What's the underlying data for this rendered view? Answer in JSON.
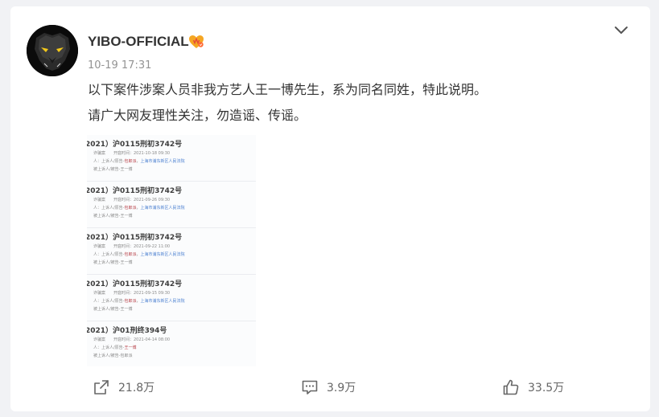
{
  "post": {
    "username": "YIBO-OFFICIAL",
    "badge_icon": "vip-heart-badge-icon",
    "timestamp": "10-19 17:31",
    "menu_icon": "chevron-down-icon",
    "content_lines": [
      "以下案件涉案人员非我方艺人王一博先生，系为同名同姓，特此说明。",
      "请广大网友理性关注，勿造谣、传谣。"
    ]
  },
  "image": {
    "cases": [
      {
        "title": "2021）沪0115刑初3742号",
        "line1": "诈骗案　　开庭时间：2021-10-18 09:30",
        "line2a": "人：上诉人/原告-",
        "line2b": "包郎派",
        "line2c": "上海市浦东新区人民法院",
        "line3": "被上诉人/被告-王一博"
      },
      {
        "title": "2021）沪0115刑初3742号",
        "line1": "诈骗案　　开庭时间：2021-09-26 09:30",
        "line2a": "人：上诉人/原告-",
        "line2b": "包郎派",
        "line2c": "上海市浦东新区人民法院",
        "line3": "被上诉人/被告-王一博"
      },
      {
        "title": "2021）沪0115刑初3742号",
        "line1": "诈骗案　　开庭时间：2021-09-22 11:00",
        "line2a": "人：上诉人/原告-",
        "line2b": "包郎派",
        "line2c": "上海市浦东新区人民法院",
        "line3": "被上诉人/被告-王一博"
      },
      {
        "title": "2021）沪0115刑初3742号",
        "line1": "诈骗案　　开庭时间：2021-09-15 09:30",
        "line2a": "人：上诉人/原告-",
        "line2b": "包郎派",
        "line2c": "上海市浦东新区人民法院",
        "line3": "被上诉人/被告-王一博"
      },
      {
        "title": "2021）沪01刑终394号",
        "line1": "诈骗案　　开庭时间：2021-04-14 08:00",
        "line2a": "人：上诉人/原告-",
        "line2b": "王一博",
        "line2c": "",
        "line3": "被上诉人/被告-包郎派"
      }
    ]
  },
  "actions": {
    "share": {
      "icon": "share-icon",
      "count": "21.8万"
    },
    "comment": {
      "icon": "comment-icon",
      "count": "3.9万"
    },
    "like": {
      "icon": "thumbs-up-icon",
      "count": "33.5万"
    }
  },
  "colors": {
    "background": "#f1f2f5",
    "card": "#ffffff",
    "text": "#333333",
    "muted": "#939393",
    "link_blue": "#4a7fd0",
    "highlight_red": "#b8434a"
  }
}
